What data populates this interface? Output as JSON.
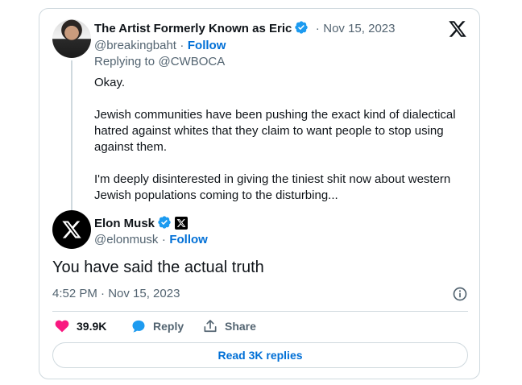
{
  "reply_tweet": {
    "author_name": "The Artist Formerly Known as Eric",
    "date": "Nov 15, 2023",
    "handle": "@breakingbaht",
    "follow_label": "Follow",
    "replying_to_prefix": "Replying to",
    "replying_to_handle": "@CWBOCA",
    "paragraphs": [
      "Okay.",
      "Jewish communities have been pushing the exact kind of dialectical hatred against whites that they claim to want people to stop using against them.",
      "I'm deeply disinterested in giving the tiniest shit now about western Jewish populations coming to the disturbing..."
    ]
  },
  "main_tweet": {
    "author_name": "Elon Musk",
    "handle": "@elonmusk",
    "follow_label": "Follow",
    "text": "You have said the actual truth",
    "timestamp": "4:52 PM · Nov 15, 2023"
  },
  "actions": {
    "like_count": "39.9K",
    "reply_label": "Reply",
    "share_label": "Share"
  },
  "read_replies_label": "Read 3K replies",
  "separator": "·",
  "colors": {
    "verified": "#1d9bf0",
    "like": "#f91880",
    "reply": "#1d9bf0",
    "link": "#006fd6"
  }
}
